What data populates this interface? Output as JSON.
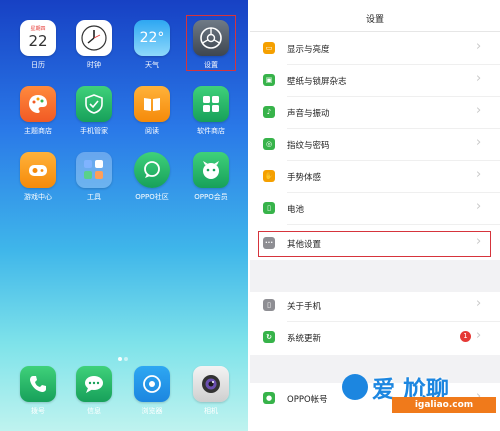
{
  "home": {
    "calendar_month": "星期四",
    "calendar_day": "22",
    "weather_temp": "22°",
    "apps": [
      {
        "label": "日历"
      },
      {
        "label": "时钟"
      },
      {
        "label": "天气"
      },
      {
        "label": "设置"
      },
      {
        "label": "主题商店"
      },
      {
        "label": "手机管家"
      },
      {
        "label": "阅读"
      },
      {
        "label": "软件商店"
      },
      {
        "label": "游戏中心"
      },
      {
        "label": "工具"
      },
      {
        "label": "OPPO社区"
      },
      {
        "label": "OPPO会员"
      },
      {
        "label": "拨号"
      },
      {
        "label": "信息"
      },
      {
        "label": "浏览器"
      },
      {
        "label": "相机"
      }
    ]
  },
  "settings": {
    "title": "设置",
    "items": [
      {
        "label": "显示与亮度",
        "color": "#f5a000"
      },
      {
        "label": "壁纸与锁屏杂志",
        "color": "#37b34a"
      },
      {
        "label": "声音与振动",
        "color": "#37b34a"
      },
      {
        "label": "指纹与密码",
        "color": "#37b34a"
      },
      {
        "label": "手势体感",
        "color": "#f5a000"
      },
      {
        "label": "电池",
        "color": "#37b34a"
      },
      {
        "label": "其他设置",
        "color": "#8e8e93"
      },
      {
        "label": "关于手机",
        "color": "#8e8e93"
      },
      {
        "label": "系统更新",
        "color": "#37b34a",
        "badge": "1"
      },
      {
        "label": "OPPO帐号",
        "color": "#37b34a"
      }
    ]
  },
  "watermark": {
    "title": "爱 尬聊",
    "url": "igaliao.com"
  },
  "colors": {
    "highlight": "#d6343c",
    "accent_green": "#37b34a",
    "accent_orange": "#f5a000"
  }
}
